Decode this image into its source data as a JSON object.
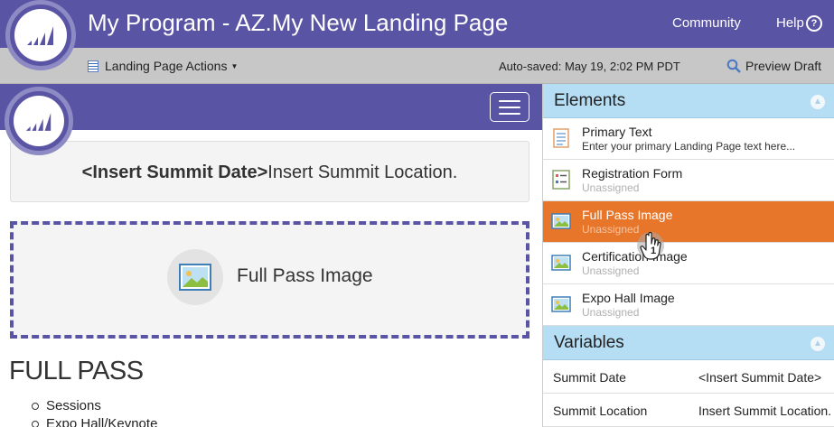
{
  "header": {
    "title": "My Program - AZ.My New Landing Page",
    "nav": {
      "community": "Community",
      "help": "Help",
      "help_icon_glyph": "?"
    }
  },
  "toolbar": {
    "actions_label": "Landing Page Actions",
    "autosave": "Auto-saved: May 19, 2:02 PM PDT",
    "preview_label": "Preview Draft"
  },
  "canvas": {
    "summit_date": "<Insert Summit Date>",
    "summit_location": "Insert Summit Location.",
    "image_placeholder": "Full Pass Image",
    "heading": "FULL PASS",
    "bullets": [
      "Sessions",
      "Expo Hall/Keynote"
    ]
  },
  "panel": {
    "elements_title": "Elements",
    "elements": [
      {
        "name": "Primary Text",
        "sub": "Enter your primary Landing Page text here...",
        "icon": "text-element-icon"
      },
      {
        "name": "Registration Form",
        "sub": "Unassigned",
        "icon": "form-element-icon"
      },
      {
        "name": "Full Pass Image",
        "sub": "Unassigned",
        "icon": "image-element-icon"
      },
      {
        "name": "Certification Image",
        "sub": "Unassigned",
        "icon": "image-element-icon"
      },
      {
        "name": "Expo Hall Image",
        "sub": "Unassigned",
        "icon": "image-element-icon"
      }
    ],
    "variables_title": "Variables",
    "variables": [
      {
        "key": "Summit Date",
        "value": "<Insert Summit Date>"
      },
      {
        "key": "Summit Location",
        "value": "Insert Summit Location."
      }
    ]
  },
  "cursor_badge": "1",
  "colors": {
    "brand": "#5a54a4",
    "accent": "#e8762a",
    "panel_head": "#b5ddf4"
  }
}
